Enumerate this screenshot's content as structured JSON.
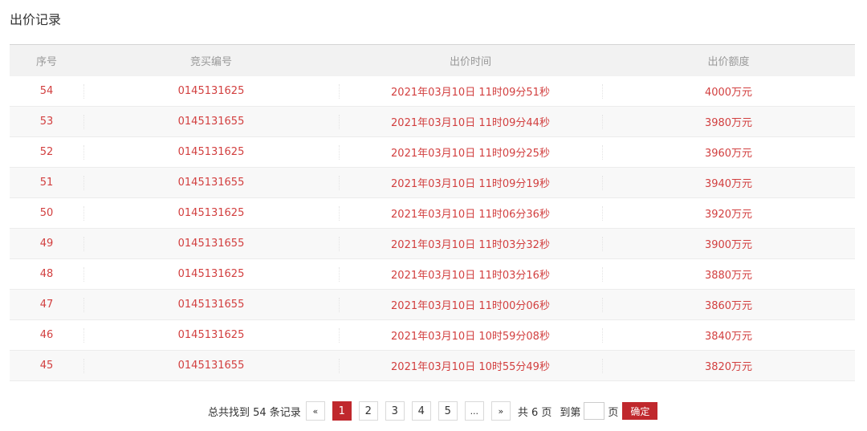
{
  "page": {
    "title": "出价记录"
  },
  "table": {
    "headers": [
      "序号",
      "竞买编号",
      "出价时间",
      "出价额度"
    ],
    "rows": [
      {
        "no": "54",
        "bid_no": "0145131625",
        "time": "2021年03月10日 11时09分51秒",
        "amount": "4000万元"
      },
      {
        "no": "53",
        "bid_no": "0145131655",
        "time": "2021年03月10日 11时09分44秒",
        "amount": "3980万元"
      },
      {
        "no": "52",
        "bid_no": "0145131625",
        "time": "2021年03月10日 11时09分25秒",
        "amount": "3960万元"
      },
      {
        "no": "51",
        "bid_no": "0145131655",
        "time": "2021年03月10日 11时09分19秒",
        "amount": "3940万元"
      },
      {
        "no": "50",
        "bid_no": "0145131625",
        "time": "2021年03月10日 11时06分36秒",
        "amount": "3920万元"
      },
      {
        "no": "49",
        "bid_no": "0145131655",
        "time": "2021年03月10日 11时03分32秒",
        "amount": "3900万元"
      },
      {
        "no": "48",
        "bid_no": "0145131625",
        "time": "2021年03月10日 11时03分16秒",
        "amount": "3880万元"
      },
      {
        "no": "47",
        "bid_no": "0145131655",
        "time": "2021年03月10日 11时00分06秒",
        "amount": "3860万元"
      },
      {
        "no": "46",
        "bid_no": "0145131625",
        "time": "2021年03月10日 10时59分08秒",
        "amount": "3840万元"
      },
      {
        "no": "45",
        "bid_no": "0145131655",
        "time": "2021年03月10日 10时55分49秒",
        "amount": "3820万元"
      }
    ]
  },
  "pagination": {
    "total_text": "总共找到 54 条记录",
    "prev_label": "«",
    "pages": [
      "1",
      "2",
      "3",
      "4",
      "5"
    ],
    "current_page": "1",
    "ellipsis": "...",
    "next_label": "»",
    "pages_total_text": "共 6 页",
    "goto_label": "到第",
    "goto_value": "",
    "page_unit": "页",
    "confirm_label": "确定"
  },
  "colors": {
    "accent": "#c0282d",
    "cell_text": "#d23f3f",
    "header_text": "#999999"
  }
}
